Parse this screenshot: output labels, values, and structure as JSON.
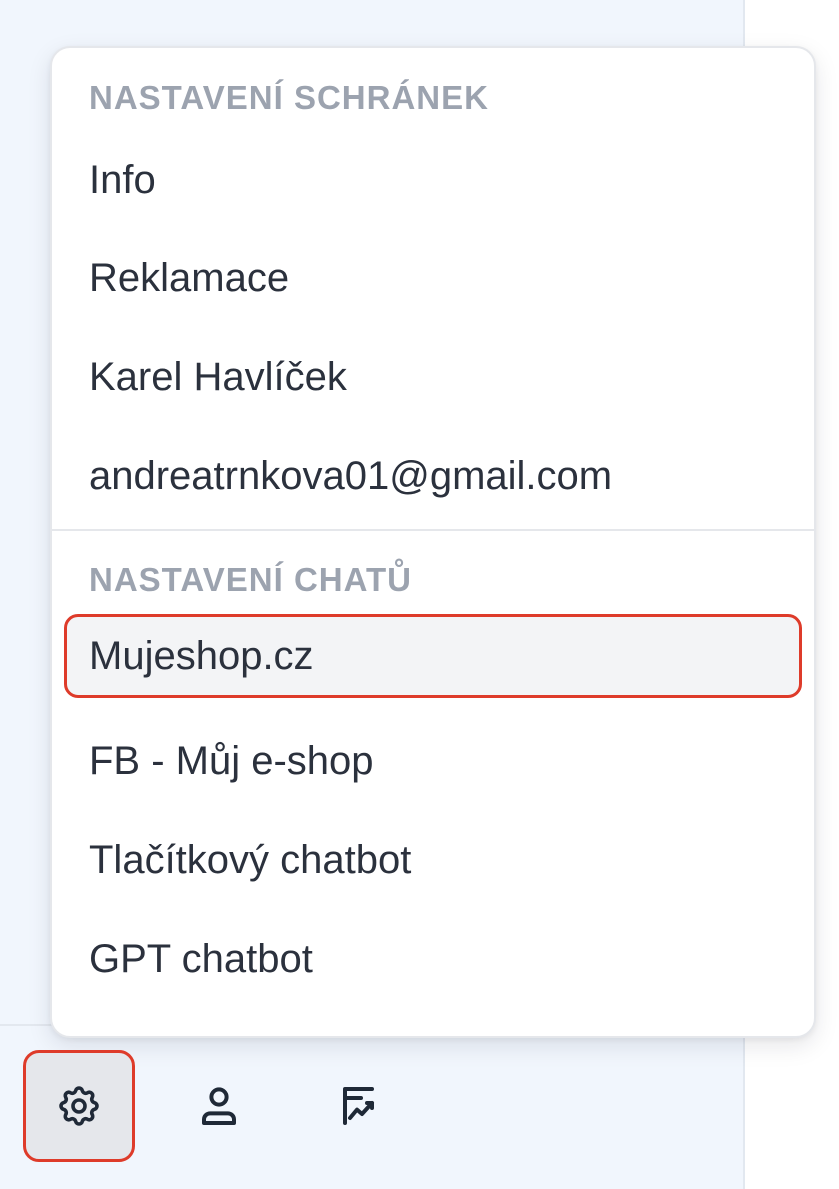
{
  "menu": {
    "mailbox_section": {
      "title": "NASTAVENÍ SCHRÁNEK",
      "items": [
        {
          "label": "Info"
        },
        {
          "label": "Reklamace"
        },
        {
          "label": "Karel Havlíček"
        },
        {
          "label": "andreatrnkova01@gmail.com"
        }
      ]
    },
    "chat_section": {
      "title": "NASTAVENÍ CHATŮ",
      "items": [
        {
          "label": "Mujeshop.cz",
          "highlighted": true
        },
        {
          "label": "FB - Můj e-shop"
        },
        {
          "label": "Tlačítkový chatbot"
        },
        {
          "label": "GPT chatbot"
        }
      ]
    }
  },
  "toolbar": {
    "buttons": [
      {
        "icon": "gear-icon",
        "active": true
      },
      {
        "icon": "user-icon",
        "active": false
      },
      {
        "icon": "chart-signature-icon",
        "active": false
      }
    ]
  },
  "colors": {
    "highlight_border": "#de3b2a",
    "sidebar_background": "#f1f6fd",
    "section_header_text": "#9ca3af",
    "menu_text": "#2b313d"
  }
}
